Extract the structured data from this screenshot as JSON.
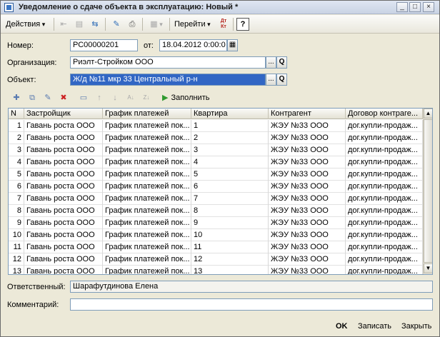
{
  "window": {
    "title": "Уведомление о сдаче объекта в эксплуатацию: Новый *",
    "minimize": "_",
    "maximize": "□",
    "close": "×"
  },
  "toolbar": {
    "actions_label": "Действия",
    "goto_label": "Перейти",
    "dtkt_label": "Дт Кт",
    "help_label": "?"
  },
  "form": {
    "number_label": "Номер:",
    "number_value": "РС00000201",
    "date_label": "от:",
    "date_value": "18.04.2012  0:00:0",
    "org_label": "Организация:",
    "org_value": "Риэлт-Стройком ООО",
    "object_label": "Объект:",
    "object_value": "Ж/д №11 мкр 33 Центральный р-н",
    "ellipsis": "...",
    "search_glyph": "Q"
  },
  "table_toolbar": {
    "fill_label": "Заполнить"
  },
  "grid": {
    "columns": [
      "N",
      "Застройщик",
      "График платежей",
      "Квартира",
      "Контрагент",
      "Договор контраге..."
    ],
    "rows": [
      [
        "1",
        "Гавань роста ООО",
        "График платежей пок...",
        "1",
        "ЖЭУ №33 ООО",
        "дог.купли-продаж..."
      ],
      [
        "2",
        "Гавань роста ООО",
        "График платежей пок...",
        "2",
        "ЖЭУ №33 ООО",
        "дог.купли-продаж..."
      ],
      [
        "3",
        "Гавань роста ООО",
        "График платежей пок...",
        "3",
        "ЖЭУ №33 ООО",
        "дог.купли-продаж..."
      ],
      [
        "4",
        "Гавань роста ООО",
        "График платежей пок...",
        "4",
        "ЖЭУ №33 ООО",
        "дог.купли-продаж..."
      ],
      [
        "5",
        "Гавань роста ООО",
        "График платежей пок...",
        "5",
        "ЖЭУ №33 ООО",
        "дог.купли-продаж..."
      ],
      [
        "6",
        "Гавань роста ООО",
        "График платежей пок...",
        "6",
        "ЖЭУ №33 ООО",
        "дог.купли-продаж..."
      ],
      [
        "7",
        "Гавань роста ООО",
        "График платежей пок...",
        "7",
        "ЖЭУ №33 ООО",
        "дог.купли-продаж..."
      ],
      [
        "8",
        "Гавань роста ООО",
        "График платежей пок...",
        "8",
        "ЖЭУ №33 ООО",
        "дог.купли-продаж..."
      ],
      [
        "9",
        "Гавань роста ООО",
        "График платежей пок...",
        "9",
        "ЖЭУ №33 ООО",
        "дог.купли-продаж..."
      ],
      [
        "10",
        "Гавань роста ООО",
        "График платежей пок...",
        "10",
        "ЖЭУ №33 ООО",
        "дог.купли-продаж..."
      ],
      [
        "11",
        "Гавань роста ООО",
        "График платежей пок...",
        "11",
        "ЖЭУ №33 ООО",
        "дог.купли-продаж..."
      ],
      [
        "12",
        "Гавань роста ООО",
        "График платежей пок...",
        "12",
        "ЖЭУ №33 ООО",
        "дог.купли-продаж..."
      ],
      [
        "13",
        "Гавань роста ООО",
        "График платежей пок...",
        "13",
        "ЖЭУ №33 ООО",
        "дог.купли-продаж..."
      ]
    ]
  },
  "footer": {
    "responsible_label": "Ответственный:",
    "responsible_value": "Шарафутдинова Елена",
    "comment_label": "Комментарий:",
    "comment_value": "",
    "ok_label": "OK",
    "save_label": "Записать",
    "close_label": "Закрыть"
  },
  "icons": {
    "title": "document-icon",
    "toolbar": [
      "back-icon",
      "list-icon",
      "refresh-icon",
      "post-document-icon",
      "print-icon",
      "structure-icon"
    ],
    "table_toolbar": [
      "add-row-icon",
      "copy-row-icon",
      "edit-row-icon",
      "delete-row-icon",
      "move-up-icon",
      "move-down-icon",
      "sort-asc-icon",
      "sort-desc-icon",
      "fill-play-icon"
    ]
  },
  "colors": {
    "selection": "#3166c4",
    "window_bg": "#ece9d8",
    "border": "#7f9db9"
  }
}
